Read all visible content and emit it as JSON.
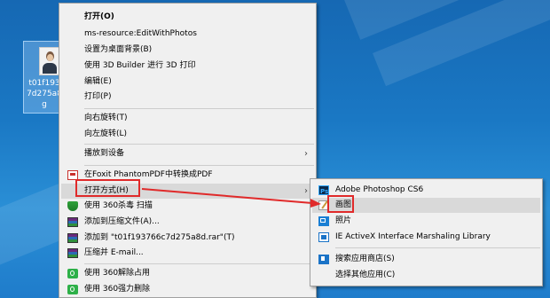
{
  "desktop": {
    "file_icon": {
      "label_lines": [
        "t01f193",
        "7d275a8",
        "g"
      ]
    }
  },
  "context_menu": {
    "items": [
      {
        "label": "打开(O)",
        "bold": true
      },
      {
        "label": "ms-resource:EditWithPhotos"
      },
      {
        "label": "设置为桌面背景(B)"
      },
      {
        "label": "使用 3D Builder 进行 3D 打印"
      },
      {
        "label": "编辑(E)"
      },
      {
        "label": "打印(P)"
      },
      {
        "label": "向右旋转(T)"
      },
      {
        "label": "向左旋转(L)"
      },
      {
        "label": "播放到设备",
        "submenu": true
      },
      {
        "label": "在Foxit PhantomPDF中转换成PDF",
        "icon": "pdf-icon"
      },
      {
        "label": "打开方式(H)",
        "submenu": true,
        "highlighted": true
      },
      {
        "label": "使用 360杀毒 扫描",
        "icon": "shield-icon"
      },
      {
        "label": "添加到压缩文件(A)...",
        "icon": "rar-icon"
      },
      {
        "label": "添加到 \"t01f193766c7d275a8d.rar\"(T)",
        "icon": "rar-icon"
      },
      {
        "label": "压缩并 E-mail...",
        "icon": "rar-icon"
      },
      {
        "label": "使用 360解除占用",
        "icon": "s360-icon"
      },
      {
        "label": "使用 360强力删除",
        "icon": "s360-icon"
      }
    ],
    "submenu_arrow": "›"
  },
  "open_with_menu": {
    "items": [
      {
        "label": "Adobe Photoshop CS6",
        "icon": "photoshop-icon"
      },
      {
        "label": "画图",
        "icon": "paint-icon",
        "highlighted": true
      },
      {
        "label": "照片",
        "icon": "photos-icon"
      },
      {
        "label": "IE ActiveX Interface Marshaling Library",
        "icon": "ie-icon"
      },
      {
        "label": "搜索应用商店(S)",
        "icon": "store-icon"
      },
      {
        "label": "选择其他应用(C)"
      }
    ]
  },
  "colors": {
    "annotation": "#e02a2a",
    "menu_bg": "#f0f0f0",
    "highlight": "#d9d9d9"
  }
}
